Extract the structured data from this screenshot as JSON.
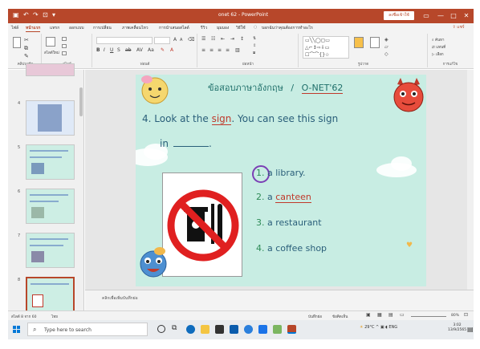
{
  "titlebar": {
    "title": "onet 62  -  PowerPoint",
    "signin_label": "ลงชื่อเข้าใช้",
    "minimize": "—",
    "maximize": "□",
    "close": "✕",
    "ribbon_display": "▭"
  },
  "tabs": {
    "items": [
      "ไฟล์",
      "หน้าแรก",
      "แทรก",
      "ออกแบบ",
      "การเปลี่ยน",
      "ภาพเคลื่อนไหว",
      "การนำเสนอสไลด์",
      "รีวิว",
      "มุมมอง",
      "วิธีใช้"
    ],
    "search_hint": "บอกฉันว่าคุณต้องการทำอะไร",
    "share_label": "แชร์"
  },
  "ribbon": {
    "groups": [
      "คลิปบอร์ด",
      "สไลด์",
      "ฟอนต์",
      "ย่อหน้า",
      "รูปวาด",
      "การแก้ไข"
    ],
    "new_slide": "สไลด์ใหม่",
    "find": "ค้นหา",
    "replace": "แทนที่",
    "select": "เลือก"
  },
  "thumbnails": {
    "numbers": [
      "4",
      "5",
      "6",
      "7",
      "8"
    ]
  },
  "slide": {
    "header_thai": "ข้อสอบภาษาอังกฤษ",
    "header_sep": "/",
    "header_onet": "O-NET'62",
    "question_pre": "4. Look at the ",
    "question_sign": "sign",
    "question_post": ". You can see this sign",
    "question_in": "in",
    "options": [
      {
        "num": "1.",
        "text": "a library."
      },
      {
        "num": "2.",
        "text": "a canteen"
      },
      {
        "num": "3.",
        "text": "a restaurant"
      },
      {
        "num": "4.",
        "text": "a coffee shop"
      }
    ]
  },
  "notes_placeholder": "คลิกเพื่อเพิ่มบันทึกย่อ",
  "status": {
    "slide_info": "สไลด์ 8 จาก 60",
    "language": "ไทย",
    "notes_label": "บันทึกย่อ",
    "comments_label": "ข้อคิดเห็น",
    "zoom": "80%"
  },
  "taskbar": {
    "search_placeholder": "Type here to search",
    "weather": "29°C",
    "lang": "ENG",
    "time": "3:02",
    "date": "13/9/2565"
  },
  "colors": {
    "accent": "#b7472a",
    "slide_bg": "#c8ede3"
  }
}
